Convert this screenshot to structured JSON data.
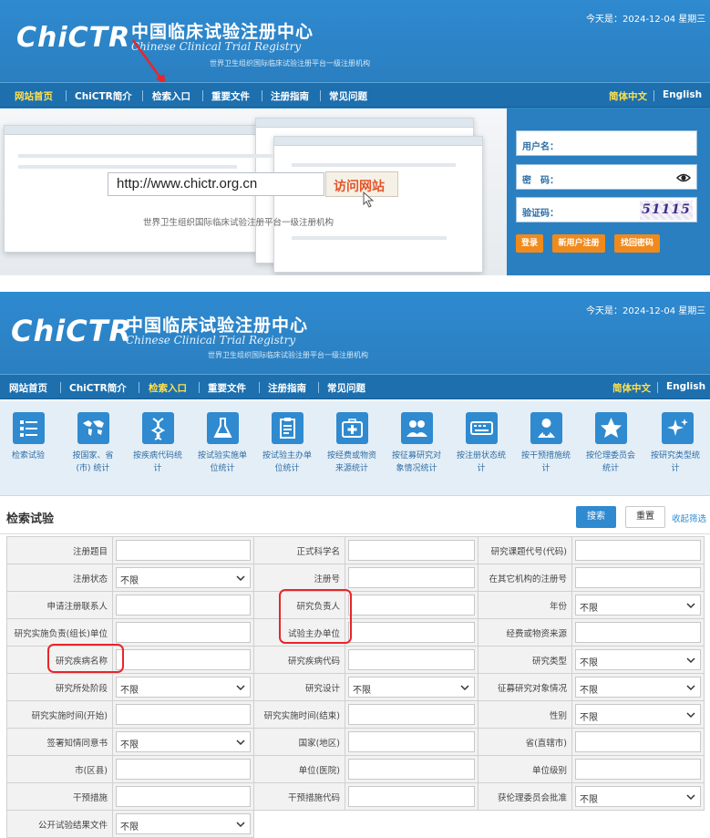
{
  "top": {
    "date": "今天是：2024-12-04 星期三",
    "logo": "ChiCTR",
    "title_cn": "中国临床试验注册中心",
    "title_en": "Chinese Clinical Trial Registry",
    "subtitle": "世界卫生组织国际临床试验注册平台一级注册机构",
    "nav": [
      "网站首页",
      "ChiCTR简介",
      "检索入口",
      "重要文件",
      "注册指南",
      "常见问题"
    ],
    "lang": [
      "简体中文",
      "English"
    ],
    "url": "http://www.chictr.org.cn",
    "visit": "访问网站",
    "hero_caption": "世界卫生组织国际临床试验注册平台一级注册机构",
    "login": {
      "username_label": "用户名：",
      "password_label": "密　码：",
      "captcha_label": "验证码：",
      "captcha_text": "51115",
      "buttons": [
        "登录",
        "新用户注册",
        "找回密码"
      ]
    }
  },
  "bottom": {
    "date": "今天是：2024-12-04 星期三",
    "logo": "ChiCTR",
    "title_cn": "中国临床试验注册中心",
    "title_en": "Chinese Clinical Trial Registry",
    "subtitle": "世界卫生组织国际临床试验注册平台一级注册机构",
    "nav": [
      "网站首页",
      "ChiCTR简介",
      "检索入口",
      "重要文件",
      "注册指南",
      "常见问题"
    ],
    "lang": [
      "简体中文",
      "English"
    ],
    "icons": [
      {
        "l1": "检索试验",
        "l2": ""
      },
      {
        "l1": "按国家、省",
        "l2": "(市) 统计"
      },
      {
        "l1": "按疾病代码统",
        "l2": "计"
      },
      {
        "l1": "按试验实施单",
        "l2": "位统计"
      },
      {
        "l1": "按试验主办单",
        "l2": "位统计"
      },
      {
        "l1": "按经费或物资",
        "l2": "来源统计"
      },
      {
        "l1": "按征募研究对",
        "l2": "象情况统计"
      },
      {
        "l1": "按注册状态统",
        "l2": "计"
      },
      {
        "l1": "按干预措施统",
        "l2": "计"
      },
      {
        "l1": "按伦理委员会",
        "l2": "统计"
      },
      {
        "l1": "按研究类型统",
        "l2": "计"
      }
    ],
    "search_title": "检索试验",
    "search_btn": "搜索",
    "reset_btn": "重置",
    "collapse": "收起筛选",
    "select_default": "不限",
    "rows": [
      [
        {
          "label": "注册题目",
          "type": "input"
        },
        {
          "label": "正式科学名",
          "type": "input"
        },
        {
          "label": "研究课题代号(代码)",
          "type": "input"
        }
      ],
      [
        {
          "label": "注册状态",
          "type": "select"
        },
        {
          "label": "注册号",
          "type": "input"
        },
        {
          "label": "在其它机构的注册号",
          "type": "input"
        }
      ],
      [
        {
          "label": "申请注册联系人",
          "type": "input"
        },
        {
          "label": "研究负责人",
          "type": "input"
        },
        {
          "label": "年份",
          "type": "select"
        }
      ],
      [
        {
          "label": "研究实施负责(组长)单位",
          "type": "input"
        },
        {
          "label": "试验主办单位",
          "type": "input"
        },
        {
          "label": "经费或物资来源",
          "type": "input"
        }
      ],
      [
        {
          "label": "研究疾病名称",
          "type": "input"
        },
        {
          "label": "研究疾病代码",
          "type": "input"
        },
        {
          "label": "研究类型",
          "type": "select"
        }
      ],
      [
        {
          "label": "研究所处阶段",
          "type": "select"
        },
        {
          "label": "研究设计",
          "type": "select"
        },
        {
          "label": "征募研究对象情况",
          "type": "select"
        }
      ],
      [
        {
          "label": "研究实施时间(开始)",
          "type": "input"
        },
        {
          "label": "研究实施时间(结束)",
          "type": "input"
        },
        {
          "label": "性别",
          "type": "select"
        }
      ],
      [
        {
          "label": "签署知情同意书",
          "type": "select"
        },
        {
          "label": "国家(地区)",
          "type": "input"
        },
        {
          "label": "省(直辖市)",
          "type": "input"
        }
      ],
      [
        {
          "label": "市(区县)",
          "type": "input"
        },
        {
          "label": "单位(医院)",
          "type": "input"
        },
        {
          "label": "单位级别",
          "type": "input"
        }
      ],
      [
        {
          "label": "干预措施",
          "type": "input"
        },
        {
          "label": "干预措施代码",
          "type": "input"
        },
        {
          "label": "获伦理委员会批准",
          "type": "select"
        }
      ],
      [
        {
          "label": "公开试验结果文件",
          "type": "select"
        }
      ]
    ]
  }
}
